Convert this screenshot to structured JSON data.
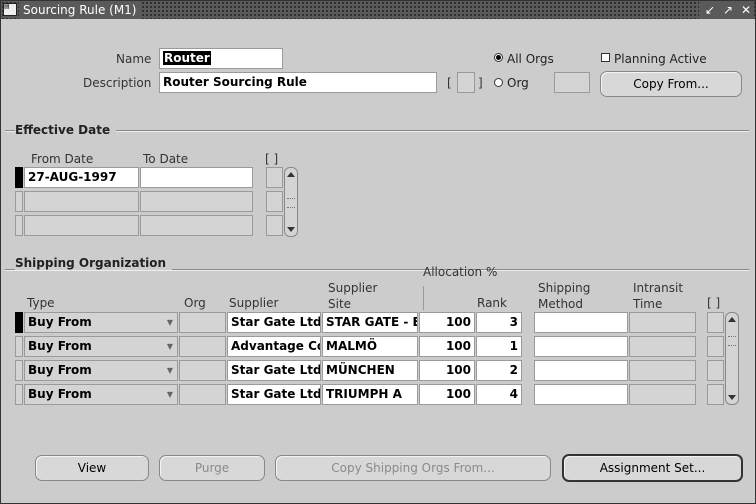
{
  "window": {
    "title": "Sourcing Rule (M1)",
    "buttons": [
      "↙",
      "↗",
      "✕"
    ]
  },
  "header": {
    "name_label": "Name",
    "name_value": "Router",
    "description_label": "Description",
    "description_value": "Router Sourcing Rule",
    "bracket_text": "[  ]",
    "all_orgs_label": "All Orgs",
    "org_label": "Org",
    "scope_selected": "All Orgs",
    "planning_active_label": "Planning Active",
    "planning_active_checked": false,
    "copy_from_label": "Copy From..."
  },
  "effective_date": {
    "section_title": "Effective Date",
    "columns": [
      "From Date",
      "To Date",
      "[ ]"
    ],
    "rows": [
      {
        "from": "27-AUG-1997",
        "to": ""
      },
      {
        "from": "",
        "to": ""
      },
      {
        "from": "",
        "to": ""
      }
    ]
  },
  "shipping": {
    "section_title": "Shipping Organization",
    "allocation_header": "Allocation %",
    "columns": {
      "type": "Type",
      "org": "Org",
      "supplier": "Supplier",
      "supplier_site": "Supplier Site",
      "allocation": "",
      "rank": "Rank",
      "shipping_method": "Shipping Method",
      "intransit_time": "Intransit Time",
      "bracket": "[ ]"
    },
    "rows": [
      {
        "type": "Buy From",
        "org": "",
        "supplier": "Star Gate Ltd",
        "site": "STAR GATE - E",
        "allocation": "100",
        "rank": "3",
        "method": "",
        "intransit": ""
      },
      {
        "type": "Buy From",
        "org": "",
        "supplier": "Advantage Cor",
        "site": "MALMÖ",
        "allocation": "100",
        "rank": "1",
        "method": "",
        "intransit": ""
      },
      {
        "type": "Buy From",
        "org": "",
        "supplier": "Star Gate Ltd",
        "site": "MÜNCHEN",
        "allocation": "100",
        "rank": "2",
        "method": "",
        "intransit": ""
      },
      {
        "type": "Buy From",
        "org": "",
        "supplier": "Star Gate Ltd",
        "site": "TRIUMPH A",
        "allocation": "100",
        "rank": "4",
        "method": "",
        "intransit": ""
      }
    ]
  },
  "footer": {
    "view": "View",
    "purge": "Purge",
    "copy_shipping": "Copy Shipping Orgs From...",
    "assignment_set": "Assignment Set..."
  }
}
